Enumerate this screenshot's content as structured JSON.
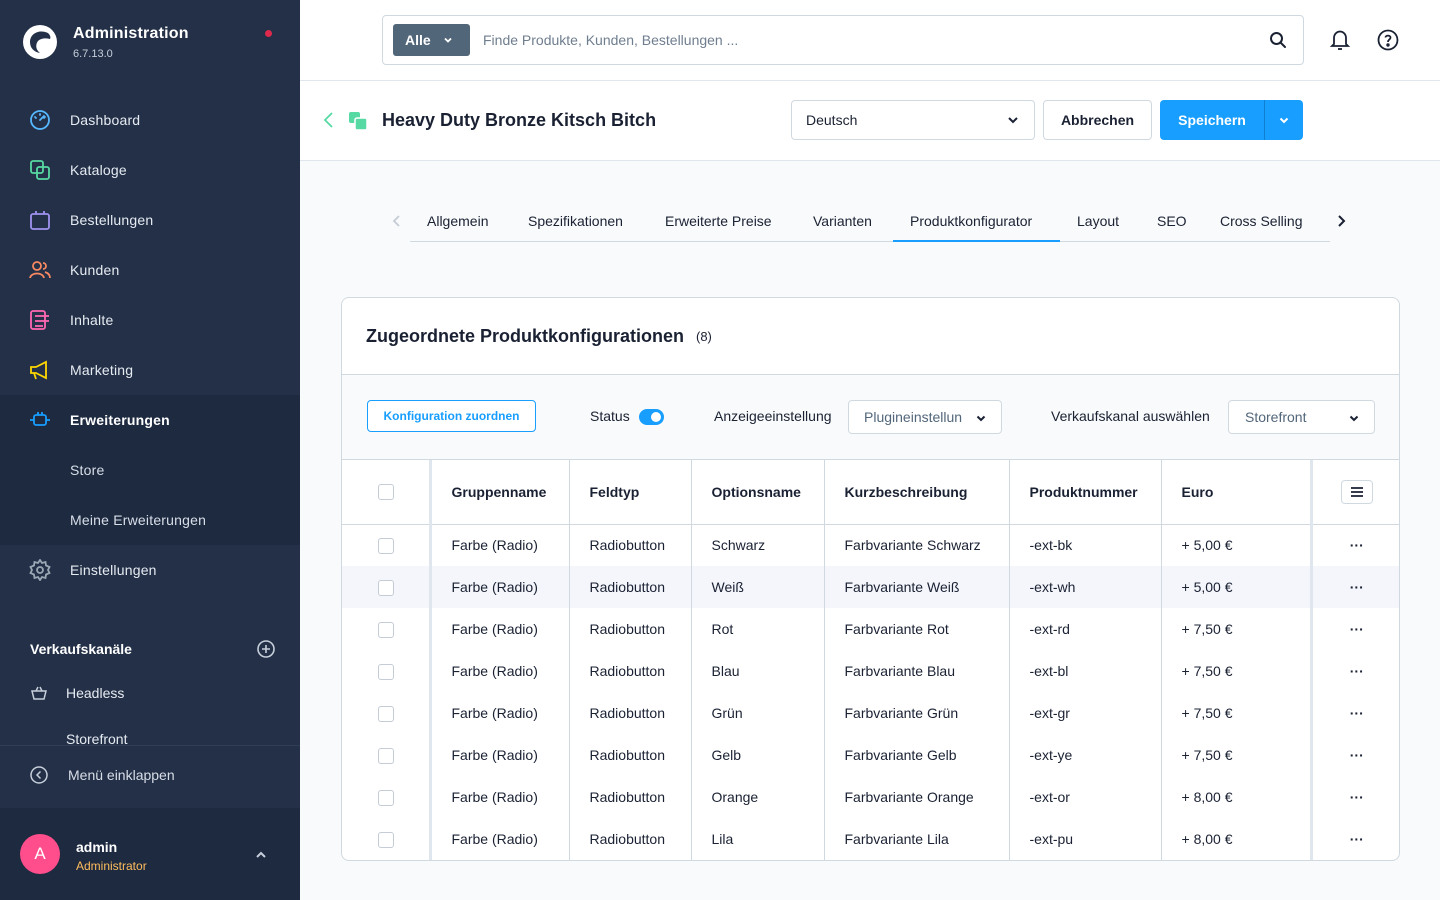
{
  "app": {
    "title": "Administration",
    "version": "6.7.13.0"
  },
  "nav": {
    "items": [
      {
        "label": "Dashboard",
        "icon": "dashboard-icon",
        "color": "#57d9a3"
      },
      {
        "label": "Kataloge",
        "icon": "catalog-icon",
        "color": "#57d9a3"
      },
      {
        "label": "Bestellungen",
        "icon": "orders-icon",
        "color": "#a092f0"
      },
      {
        "label": "Kunden",
        "icon": "customers-icon",
        "color": "#f88962"
      },
      {
        "label": "Inhalte",
        "icon": "content-icon",
        "color": "#ff68b4"
      },
      {
        "label": "Marketing",
        "icon": "marketing-icon",
        "color": "#ffd700"
      },
      {
        "label": "Erweiterungen",
        "icon": "extensions-icon",
        "color": "#189eff"
      },
      {
        "label": "Store"
      },
      {
        "label": "Meine Erweiterungen"
      },
      {
        "label": "Einstellungen",
        "icon": "settings-icon",
        "color": "#9aa8b5"
      }
    ]
  },
  "sales_channels": {
    "heading": "Verkaufskanäle",
    "items": [
      {
        "label": "Headless"
      },
      {
        "label": "Storefront"
      }
    ]
  },
  "collapse_label": "Menü einklappen",
  "user": {
    "initial": "A",
    "name": "admin",
    "role": "Administrator"
  },
  "search": {
    "type": "Alle",
    "placeholder": "Finde Produkte, Kunden, Bestellungen ..."
  },
  "page": {
    "title": "Heavy Duty Bronze Kitsch Bitch",
    "language": "Deutsch",
    "cancel": "Abbrechen",
    "save": "Speichern"
  },
  "tabs": [
    {
      "label": "Allgemein"
    },
    {
      "label": "Spezifikationen"
    },
    {
      "label": "Erweiterte Preise"
    },
    {
      "label": "Varianten"
    },
    {
      "label": "Produktkonfigurator",
      "active": true
    },
    {
      "label": "Layout"
    },
    {
      "label": "SEO"
    },
    {
      "label": "Cross Selling"
    }
  ],
  "card": {
    "title": "Zugeordnete Produktkonfigurationen",
    "count": "(8)",
    "assign_button": "Konfiguration zuordnen",
    "status_label": "Status",
    "display_label": "Anzeigeeinstellung",
    "display_value": "Plugineinstellung",
    "channel_label": "Verkaufskanal auswählen",
    "channel_value": "Storefront"
  },
  "table": {
    "columns": [
      "Gruppenname",
      "Feldtyp",
      "Optionsname",
      "Kurzbeschreibung",
      "Produktnummer",
      "Euro"
    ],
    "rows": [
      [
        "Farbe (Radio)",
        "Radiobutton",
        "Schwarz",
        "Farbvariante Schwarz",
        "-ext-bk",
        "+ 5,00 €"
      ],
      [
        "Farbe (Radio)",
        "Radiobutton",
        "Weiß",
        "Farbvariante Weiß",
        "-ext-wh",
        "+ 5,00 €"
      ],
      [
        "Farbe (Radio)",
        "Radiobutton",
        "Rot",
        "Farbvariante Rot",
        "-ext-rd",
        "+ 7,50 €"
      ],
      [
        "Farbe (Radio)",
        "Radiobutton",
        "Blau",
        "Farbvariante Blau",
        "-ext-bl",
        "+ 7,50 €"
      ],
      [
        "Farbe (Radio)",
        "Radiobutton",
        "Grün",
        "Farbvariante Grün",
        "-ext-gr",
        "+ 7,50 €"
      ],
      [
        "Farbe (Radio)",
        "Radiobutton",
        "Gelb",
        "Farbvariante Gelb",
        "-ext-ye",
        "+ 7,50 €"
      ],
      [
        "Farbe (Radio)",
        "Radiobutton",
        "Orange",
        "Farbvariante Orange",
        "-ext-or",
        "+ 8,00 €"
      ],
      [
        "Farbe (Radio)",
        "Radiobutton",
        "Lila",
        "Farbvariante Lila",
        "-ext-pu",
        "+ 8,00 €"
      ]
    ]
  },
  "colors": {
    "sidebar": "#233047",
    "accent": "#189eff",
    "avatar": "#ff4e8b",
    "role": "#ffbd5d",
    "notification_dot": "#de294c"
  }
}
